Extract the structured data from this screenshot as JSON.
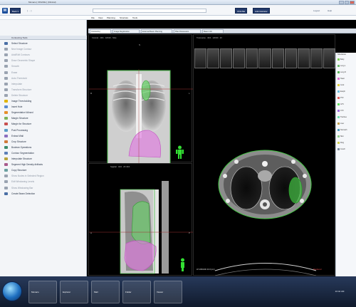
{
  "window": {
    "title": "Monaco  [ ONLINE ]  (Clinical)"
  },
  "appbar": {
    "logo_text": "M",
    "nav_btn": "Back  ▾",
    "path_text": "[ … ]",
    "right_buttons": [
      "ONLINE",
      "Administrator"
    ],
    "right_links": [
      "Logout",
      "Help"
    ]
  },
  "menu": [
    "File",
    "View",
    "Planning",
    "Structure",
    "Tools"
  ],
  "tabs": [
    "Contouring",
    "Image Registration",
    "External Beam Planning",
    "Plan Parameters",
    "Beam Info"
  ],
  "left_panel": {
    "header": "Contouring Tools",
    "items": [
      {
        "label": "Select Structure",
        "dim": false,
        "color": "#4a6fa5"
      },
      {
        "label": "New Image Contour",
        "dim": true,
        "color": "#9aa3b1"
      },
      {
        "label": "Add/Edit Contours",
        "dim": true,
        "color": "#9aa3b1"
      },
      {
        "label": "Draw Geometric Shape",
        "dim": true,
        "color": "#9aa3b1"
      },
      {
        "label": "Smooth",
        "dim": true,
        "color": "#9aa3b1"
      },
      {
        "label": "Erase",
        "dim": true,
        "color": "#9aa3b1"
      },
      {
        "label": "Auto-Threshold",
        "dim": true,
        "color": "#9aa3b1"
      },
      {
        "label": "Interpolate",
        "dim": true,
        "color": "#9aa3b1"
      },
      {
        "label": "Transform Structure",
        "dim": true,
        "color": "#9aa3b1"
      },
      {
        "label": "Delete Structure",
        "dim": true,
        "color": "#9aa3b1"
      },
      {
        "label": "Image Thresholding",
        "dim": false,
        "color": "#e0b400"
      },
      {
        "label": "Insert Hole",
        "dim": false,
        "color": "#5b8bd0"
      },
      {
        "label": "Segmentation Wizard",
        "dim": false,
        "color": "#e58f2c"
      },
      {
        "label": "Margin Structure",
        "dim": false,
        "color": "#7bb35a"
      },
      {
        "label": "Margin for Structure",
        "dim": false,
        "color": "#c85050"
      },
      {
        "label": "Post Processing",
        "dim": false,
        "color": "#5a9dc8"
      },
      {
        "label": "Extract Wall",
        "dim": false,
        "color": "#8b6fc0"
      },
      {
        "label": "Crop Structure",
        "dim": false,
        "color": "#d07a3a"
      },
      {
        "label": "Boolean Operations",
        "dim": false,
        "color": "#3c8c6c"
      },
      {
        "label": "Contour Segmentation",
        "dim": false,
        "color": "#5c7fb8"
      },
      {
        "label": "Interpolate Structure",
        "dim": false,
        "color": "#b8a33c"
      },
      {
        "label": "Segment High Density Artifacts",
        "dim": false,
        "color": "#a85a8c"
      },
      {
        "label": "Copy Structure",
        "dim": false,
        "color": "#6aa0a0"
      },
      {
        "label": "Show Nodes in Selected Region",
        "dim": true,
        "color": "#9aa3b1"
      },
      {
        "label": "Edit Windowing Levels",
        "dim": true,
        "color": "#9aa3b1"
      },
      {
        "label": "Show Windowing Bar",
        "dim": true,
        "color": "#9aa3b1"
      },
      {
        "label": "Create Beam Detection",
        "dim": false,
        "color": "#4a6fa5"
      }
    ]
  },
  "viewports": {
    "coronal": {
      "header": "Coronal · 40/4 · 120/20 · Slice",
      "orientation_top": "S",
      "orientation_bottom": "I",
      "orientation_left": "R",
      "orientation_right": "L"
    },
    "sagittal": {
      "header": "Sagittal · 40/4 · ZZ 40/4",
      "orientation_top": "S",
      "orientation_bottom": "I",
      "orientation_left": "A",
      "orientation_right": "P"
    },
    "transverse": {
      "header": "Transverse · 40/4 · 120/20 · 2X",
      "footer_left": "W 1080/200 40.0 [cm]",
      "footer_right": "Rendered"
    }
  },
  "right_panel": {
    "header": "Structures",
    "rows": [
      {
        "label": "Body",
        "color": "#7fd05a"
      },
      {
        "label": "Lung L",
        "color": "#6ec06e"
      },
      {
        "label": "Lung R",
        "color": "#5ab35a"
      },
      {
        "label": "Heart",
        "color": "#e070d0"
      },
      {
        "label": "Cord",
        "color": "#e0d040"
      },
      {
        "label": "Esoph",
        "color": "#70c0e0"
      },
      {
        "label": "PTV",
        "color": "#e06060"
      },
      {
        "label": "GTV",
        "color": "#60e060"
      },
      {
        "label": "CTV",
        "color": "#a070e0"
      },
      {
        "label": "Trachea",
        "color": "#70e0b0"
      },
      {
        "label": "Liver",
        "color": "#c0a050"
      },
      {
        "label": "Stomach",
        "color": "#50a0c0"
      },
      {
        "label": "Skin",
        "color": "#90d090"
      },
      {
        "label": "Ring",
        "color": "#d0d050"
      },
      {
        "label": "Couch",
        "color": "#8090a0"
      }
    ]
  },
  "taskbar": {
    "apps": [
      "Monaco",
      "Explorer",
      "Mail",
      "Folder",
      "Viewer"
    ],
    "clock": "10:42 AM"
  }
}
